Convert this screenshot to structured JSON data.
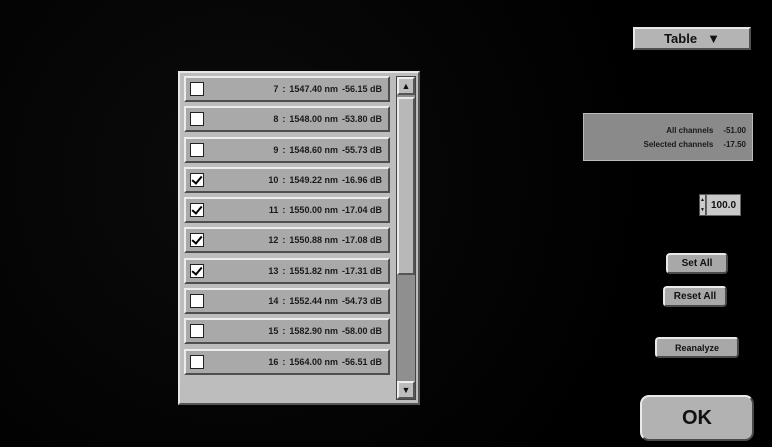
{
  "channels": [
    {
      "num": "7",
      "wavelength": "1547.40 nm",
      "power": "-56.15 dB",
      "checked": false
    },
    {
      "num": "8",
      "wavelength": "1548.00 nm",
      "power": "-53.80 dB",
      "checked": false
    },
    {
      "num": "9",
      "wavelength": "1548.60 nm",
      "power": "-55.73 dB",
      "checked": false
    },
    {
      "num": "10",
      "wavelength": "1549.22 nm",
      "power": "-16.96 dB",
      "checked": true
    },
    {
      "num": "11",
      "wavelength": "1550.00 nm",
      "power": "-17.04 dB",
      "checked": true
    },
    {
      "num": "12",
      "wavelength": "1550.88 nm",
      "power": "-17.08 dB",
      "checked": true
    },
    {
      "num": "13",
      "wavelength": "1551.82 nm",
      "power": "-17.31 dB",
      "checked": true
    },
    {
      "num": "14",
      "wavelength": "1552.44 nm",
      "power": "-54.73 dB",
      "checked": false
    },
    {
      "num": "15",
      "wavelength": "1582.90 nm",
      "power": "-58.00 dB",
      "checked": false
    },
    {
      "num": "16",
      "wavelength": "1564.00 nm",
      "power": "-56.51 dB",
      "checked": false
    }
  ],
  "separator": ":",
  "scroll_up_icon": "▲",
  "scroll_down_icon": "▼",
  "view_selector": {
    "label": "Table",
    "icon": "chevron-down-icon",
    "arrow": "▼"
  },
  "info": {
    "line1_label": "All channels",
    "line1_value": "-51.00",
    "line2_label": "Selected channels",
    "line2_value": "-17.50"
  },
  "spin": {
    "value": "100.0",
    "up": "▲",
    "down": "▼"
  },
  "buttons": {
    "set_all": "Set All",
    "reset_all": "Reset All",
    "reanalyze": "Reanalyze",
    "ok": "OK"
  }
}
